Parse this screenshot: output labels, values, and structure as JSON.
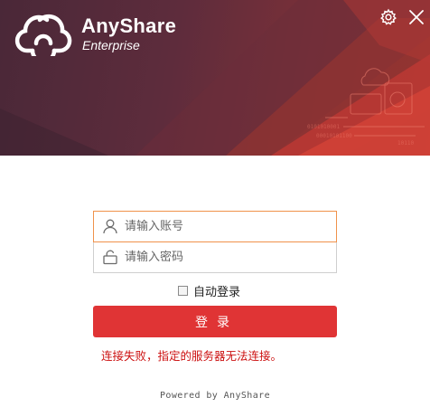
{
  "header": {
    "brand_name": "AnyShare",
    "brand_sub": "Enterprise",
    "icons": {
      "logo": "anyshare-cloud-logo",
      "settings": "gear-icon",
      "close": "close-icon"
    }
  },
  "login": {
    "account_placeholder": "请输入账号",
    "account_value": "",
    "password_placeholder": "请输入密码",
    "password_value": "",
    "remember_label": "自动登录",
    "remember_checked": false,
    "login_button": "登录",
    "error_message": "连接失败，指定的服务器无法连接。"
  },
  "footer": {
    "text": "Powered by AnyShare"
  },
  "colors": {
    "accent": "#e03435",
    "error": "#cc1010",
    "focus_border": "#f0924a",
    "banner_dark": "#4a2838"
  }
}
